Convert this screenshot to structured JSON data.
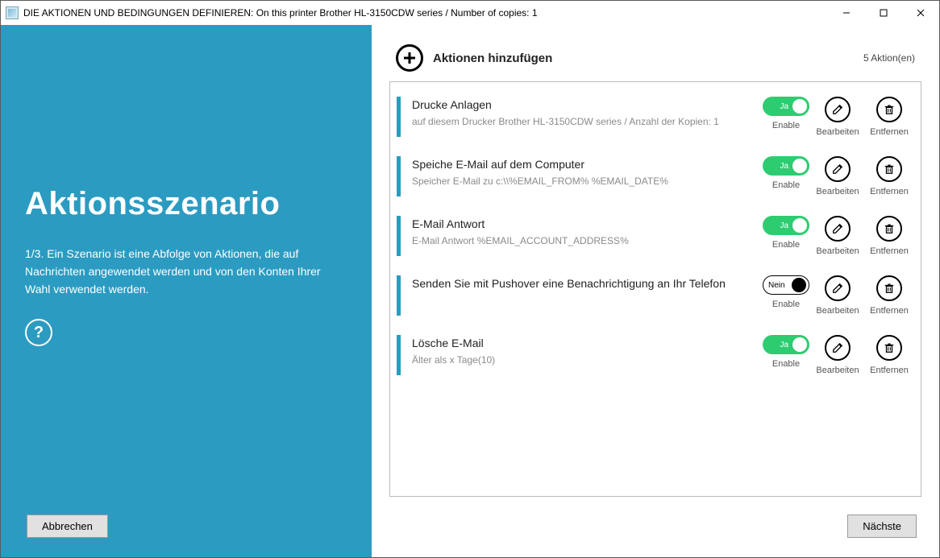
{
  "titlebar": {
    "title": "DIE AKTIONEN UND BEDINGUNGEN DEFINIEREN: On this printer Brother HL-3150CDW series / Number of copies: 1"
  },
  "left": {
    "heading": "Aktionsszenario",
    "description": "1/3. Ein Szenario ist eine Abfolge von Aktionen, die auf Nachrichten angewendet werden und von den Konten Ihrer Wahl verwendet werden.",
    "help": "?",
    "cancel": "Abbrechen"
  },
  "right": {
    "add_label": "Aktionen hinzufügen",
    "count_label": "5  Aktion(en)",
    "next": "Nächste",
    "labels": {
      "enable": "Enable",
      "edit": "Bearbeiten",
      "remove": "Entfernen",
      "on": "Ja",
      "off": "Nein"
    },
    "actions": [
      {
        "title": "Drucke Anlagen",
        "subtitle": "auf diesem Drucker Brother HL-3150CDW series / Anzahl der Kopien: 1",
        "enabled": true
      },
      {
        "title": "Speiche E-Mail auf dem Computer",
        "subtitle": "Speicher E-Mail zu c:\\\\%EMAIL_FROM% %EMAIL_DATE%",
        "enabled": true
      },
      {
        "title": "E-Mail Antwort",
        "subtitle": "E-Mail Antwort %EMAIL_ACCOUNT_ADDRESS%",
        "enabled": true
      },
      {
        "title": "Senden Sie mit Pushover eine Benachrichtigung an Ihr Telefon",
        "subtitle": "",
        "enabled": false
      },
      {
        "title": "Lösche E-Mail",
        "subtitle": "Älter als x Tage(10)",
        "enabled": true
      }
    ]
  }
}
